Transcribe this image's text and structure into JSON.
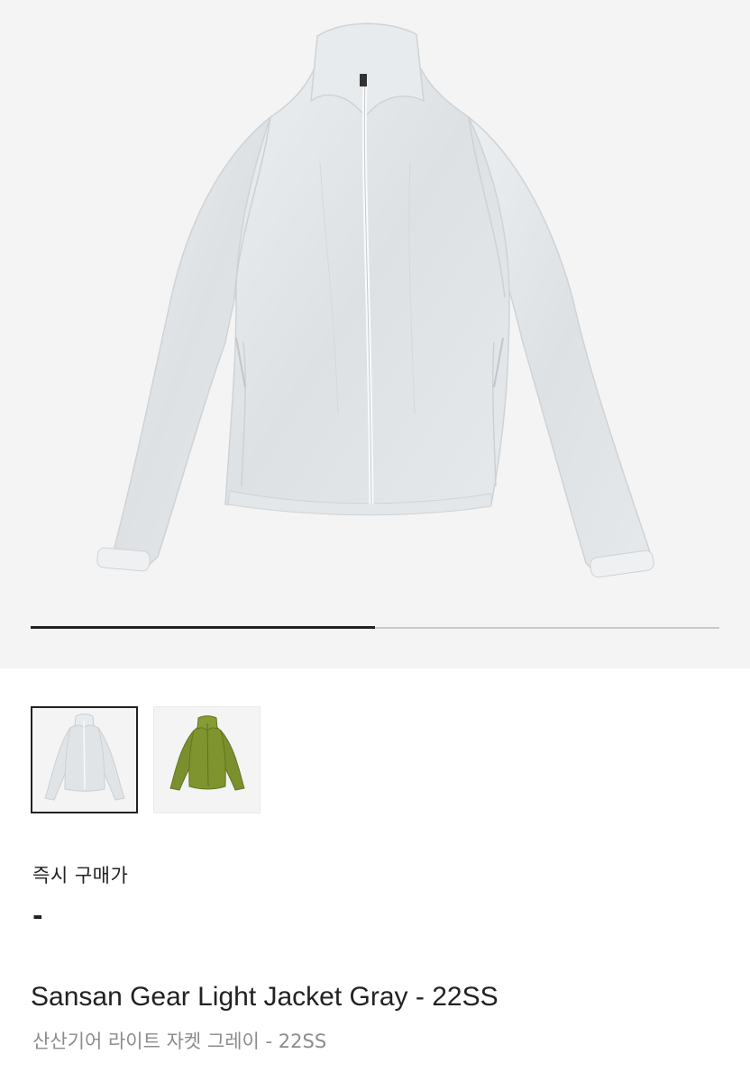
{
  "gallery": {
    "main_image_alt": "Sansan Gear Light Jacket Gray",
    "progress_fraction": 0.5,
    "thumbnails": [
      {
        "color": "#e1e4e7",
        "selected": true
      },
      {
        "color": "#7a8f2e",
        "selected": false
      }
    ]
  },
  "price": {
    "label": "즉시 구매가",
    "value": "-"
  },
  "product": {
    "name_en": "Sansan Gear Light Jacket Gray - 22SS",
    "name_ko": "산산기어 라이트 자켓 그레이 - 22SS"
  },
  "colors": {
    "hero_bg": "#f4f4f4",
    "jacket_gray": "#e1e4e7",
    "jacket_olive": "#7a8f2e",
    "text_primary": "#222222",
    "text_secondary": "#8c8c8c"
  }
}
